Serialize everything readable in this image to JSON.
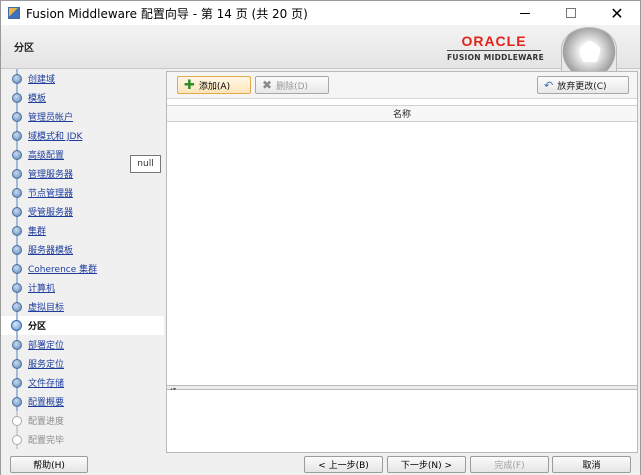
{
  "window": {
    "title": "Fusion Middleware 配置向导 - 第 14 页 (共 20 页)",
    "min_icon": "minimize-icon",
    "max_icon": "maximize-icon",
    "close_icon": "close-icon",
    "close_glyph": "✕"
  },
  "header": {
    "page_title": "分区",
    "brand": "ORACLE",
    "brand_sub": "FUSION MIDDLEWARE",
    "brand_color": "#e2231a"
  },
  "nav": {
    "items": [
      {
        "label": "创建域",
        "state": "done"
      },
      {
        "label": "模板",
        "state": "done"
      },
      {
        "label": "管理员帐户",
        "state": "done"
      },
      {
        "label": "域模式和 JDK",
        "state": "done"
      },
      {
        "label": "高级配置",
        "state": "done"
      },
      {
        "label": "管理服务器",
        "state": "done"
      },
      {
        "label": "节点管理器",
        "state": "done"
      },
      {
        "label": "受管服务器",
        "state": "done"
      },
      {
        "label": "集群",
        "state": "done"
      },
      {
        "label": "服务器模板",
        "state": "done"
      },
      {
        "label": "Coherence 集群",
        "state": "done"
      },
      {
        "label": "计算机",
        "state": "done"
      },
      {
        "label": "虚拟目标",
        "state": "done"
      },
      {
        "label": "分区",
        "state": "current"
      },
      {
        "label": "部署定位",
        "state": "done"
      },
      {
        "label": "服务定位",
        "state": "done"
      },
      {
        "label": "文件存储",
        "state": "done"
      },
      {
        "label": "配置概要",
        "state": "done"
      },
      {
        "label": "配置进度",
        "state": "future"
      },
      {
        "label": "配置完毕",
        "state": "future"
      }
    ]
  },
  "tooltip": {
    "text": "null"
  },
  "toolbar": {
    "add_label": "添加(A)",
    "delete_label": "删除(D)",
    "revert_label": "放弃更改(C)",
    "add_icon": "plus-icon",
    "delete_icon": "x-icon",
    "revert_icon": "undo-icon"
  },
  "table": {
    "columns": [
      "名称"
    ],
    "rows": []
  },
  "footer": {
    "help_label": "帮助(H)",
    "back_label": "< 上一步(B)",
    "next_label": "下一步(N) >",
    "finish_label": "完成(F)",
    "cancel_label": "取消"
  }
}
